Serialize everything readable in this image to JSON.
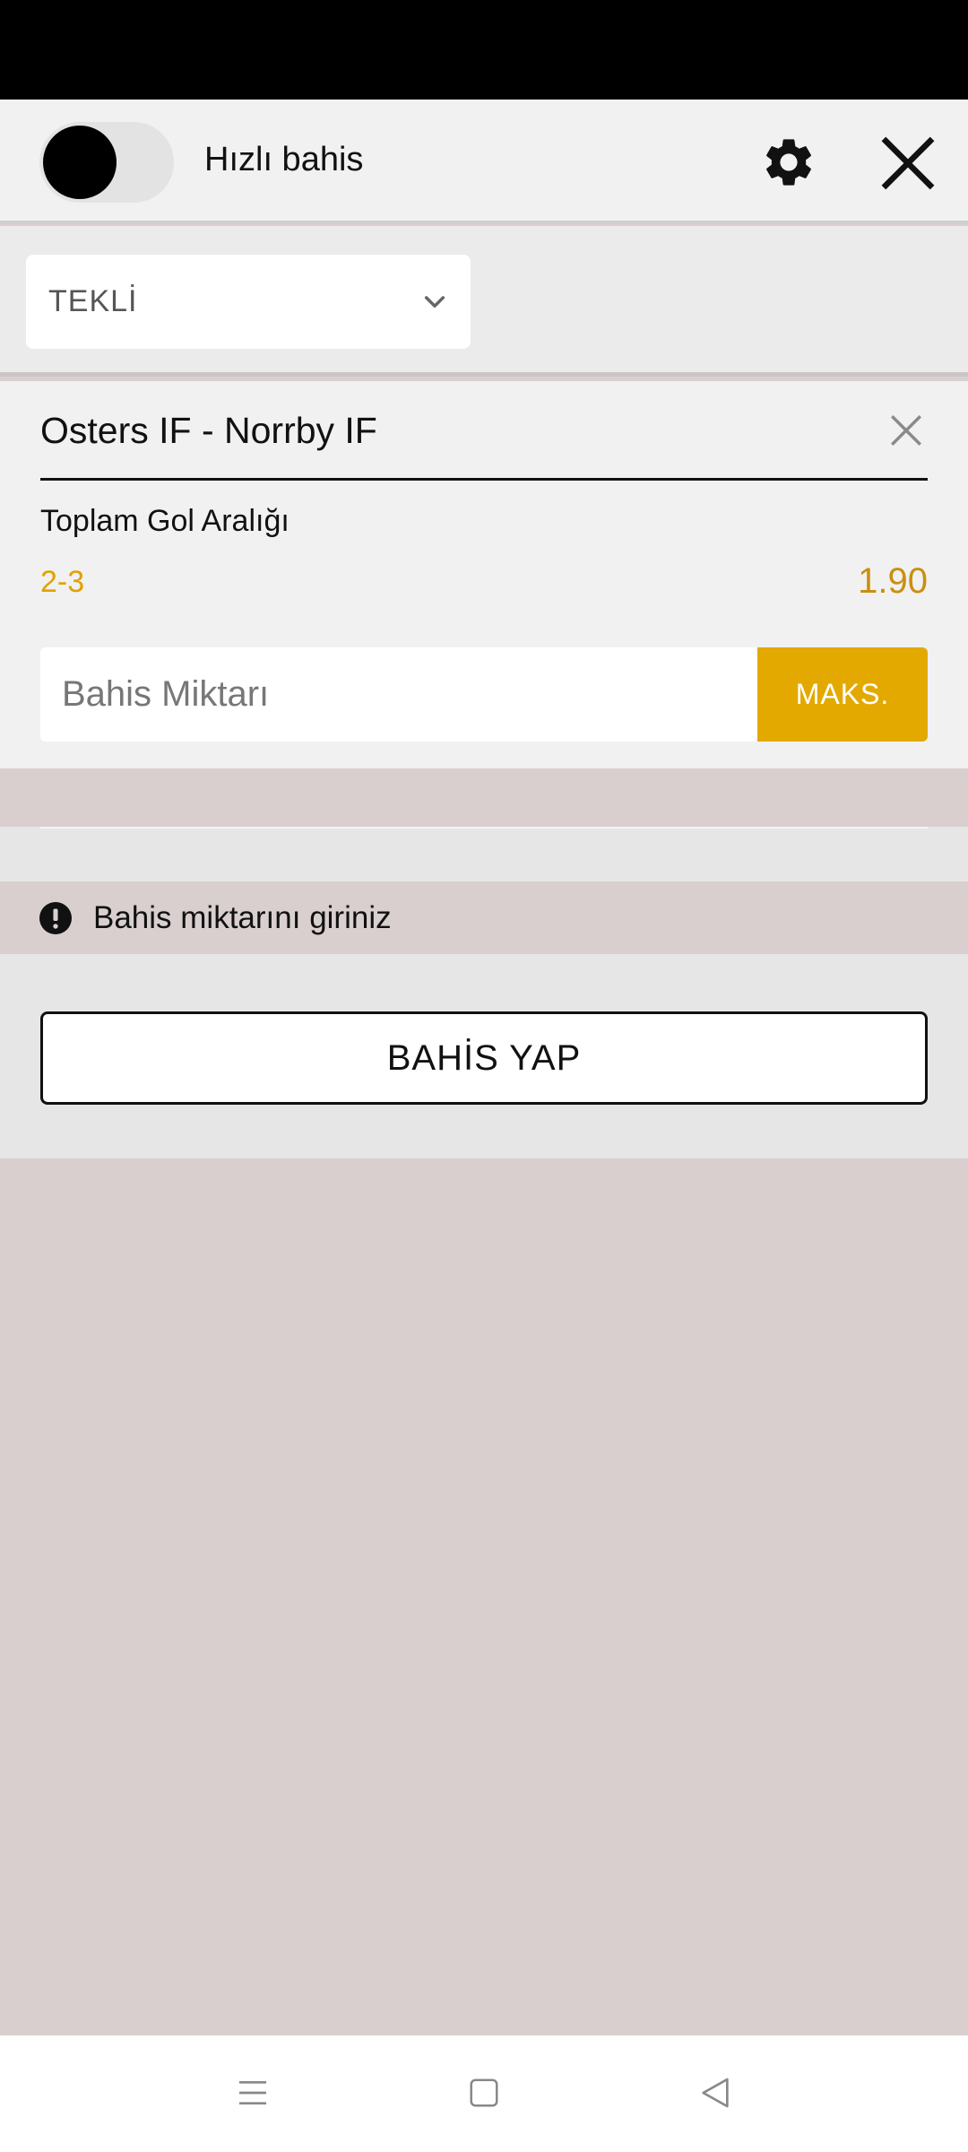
{
  "header": {
    "quick_bet_label": "Hızlı bahis",
    "quick_bet_enabled": false
  },
  "bet_type": {
    "selected": "TEKLİ"
  },
  "bet": {
    "match": "Osters IF - Norrby IF",
    "market": "Toplam Gol Aralığı",
    "selection": "2-3",
    "odds": "1.90"
  },
  "stake": {
    "placeholder": "Bahis Miktarı",
    "value": "",
    "max_label": "MAKS."
  },
  "warning": {
    "text": "Bahis miktarını giriniz"
  },
  "actions": {
    "place_bet_label": "BAHİS YAP"
  },
  "colors": {
    "accent": "#e3a900",
    "selection": "#e1a200",
    "odds": "#c98f0e",
    "backdrop": "#d9cfcf"
  },
  "icons": {
    "settings": "gear-icon",
    "close": "close-icon",
    "remove_selection": "close-icon",
    "dropdown": "chevron-down-icon",
    "warning": "exclamation-circle-icon",
    "nav": [
      "menu-icon",
      "home-square-icon",
      "back-triangle-icon"
    ]
  }
}
